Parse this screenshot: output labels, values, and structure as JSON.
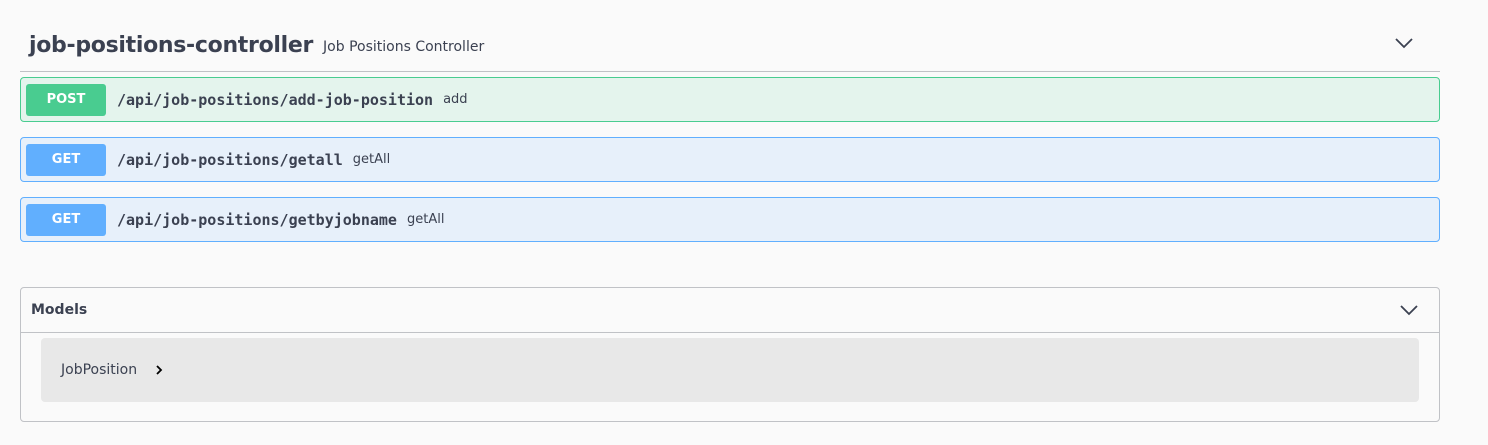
{
  "controller": {
    "name": "job-positions-controller",
    "description": "Job Positions Controller"
  },
  "operations": [
    {
      "method": "POST",
      "path": "/api/job-positions/add-job-position",
      "summary": "add"
    },
    {
      "method": "GET",
      "path": "/api/job-positions/getall",
      "summary": "getAll"
    },
    {
      "method": "GET",
      "path": "/api/job-positions/getbyjobname",
      "summary": "getAll"
    }
  ],
  "models": {
    "title": "Models",
    "items": [
      {
        "name": "JobPosition"
      }
    ]
  },
  "colors": {
    "post": "#49cc90",
    "get": "#61affe",
    "text": "#3b4151"
  },
  "icons": {
    "expand": "chevron-down-icon",
    "model_expand": "chevron-right-icon"
  }
}
